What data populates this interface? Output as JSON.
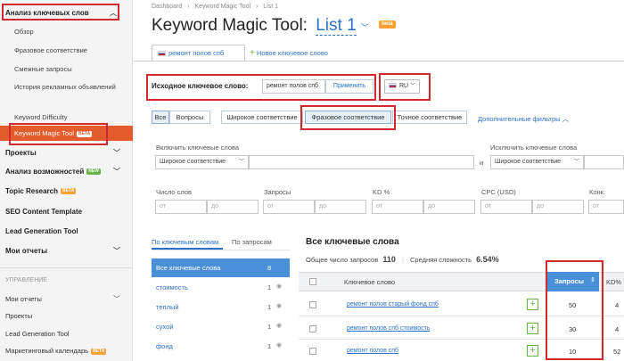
{
  "sidebar": {
    "section_title": "Анализ ключевых слов",
    "sub_items": [
      "Обзор",
      "Фразовое соответствие",
      "Смежные запросы",
      "История рекламных объявлений"
    ],
    "kd": "Keyword Difficulty",
    "kmt": "Keyword Magic Tool",
    "kmt_badge": "BETA",
    "projects": "Проекты",
    "competitors": "Анализ возможностей",
    "competitors_badge": "NEW",
    "topic": "Topic Research",
    "topic_badge": "BETA",
    "seo_template": "SEO Content Template",
    "lead": "Lead Generation Tool",
    "reports": "Мои отчеты",
    "management": "УПРАВЛЕНИЕ",
    "m_reports": "Мои отчеты",
    "m_projects": "Проекты",
    "m_lead": "Lead Generation Tool",
    "m_calendar": "Маркетинговый календарь",
    "m_calendar_badge": "BETA"
  },
  "breadcrumb": {
    "dashboard": "Dashboard",
    "sep1": "›",
    "tool": "Keyword Magic Tool",
    "sep2": "›",
    "list": "List 1"
  },
  "header": {
    "title": "Keyword Magic Tool:",
    "list_name": "List 1",
    "beta": "beta"
  },
  "tabs": {
    "active": "ремонт полов спб",
    "new": "Новое ключевое слово"
  },
  "seed": {
    "label": "Исходное ключевое слово:",
    "value": "ремонт полов спб",
    "apply": "Применить",
    "db": "RU"
  },
  "match": {
    "all": "Все",
    "questions": "Вопросы",
    "broad": "Широкое соответствие",
    "phrase": "Фразовое соответствие",
    "exact": "Точное соответствие",
    "more": "Дополнительные фильтры"
  },
  "include": {
    "label": "Включить ключевые слова",
    "select": "Широкое соответствие",
    "and": "и"
  },
  "exclude": {
    "label": "Исключить ключевые слова",
    "select": "Широкое соответствие"
  },
  "ranges": {
    "words": "Число слов",
    "volume": "Запросы",
    "kd": "KD %",
    "cpc": "CPC (USD)",
    "comp": "Конк.",
    "from": "от",
    "to": "до"
  },
  "groups": {
    "tab_keywords": "По ключевым словам",
    "tab_volume": "По запросам",
    "items": [
      {
        "label": "Все ключевые слова",
        "count": "8"
      },
      {
        "label": "стоимость",
        "count": "1"
      },
      {
        "label": "теплый",
        "count": "1"
      },
      {
        "label": "сухой",
        "count": "1"
      },
      {
        "label": "фонд",
        "count": "1"
      }
    ]
  },
  "results": {
    "title": "Все ключевые слова",
    "total_label": "Общее число запросов",
    "total_value": "110",
    "avg_label": "Средняя сложность",
    "avg_value": "6.54%",
    "col_keyword": "Ключевое слово",
    "col_volume": "Запросы",
    "col_kd": "KD%",
    "rows": [
      {
        "keyword": "ремонт полов старый фонд спб",
        "volume": "50",
        "kd": "4"
      },
      {
        "keyword": "ремонт полов спб стоимость",
        "volume": "30",
        "kd": "4"
      },
      {
        "keyword": "ремонт полов спб",
        "volume": "10",
        "kd": "52"
      }
    ]
  },
  "colors": {
    "accent": "#e45b2c",
    "highlight": "#d3282e",
    "link": "#2a71c7",
    "selected_blue": "#4a90d9"
  }
}
